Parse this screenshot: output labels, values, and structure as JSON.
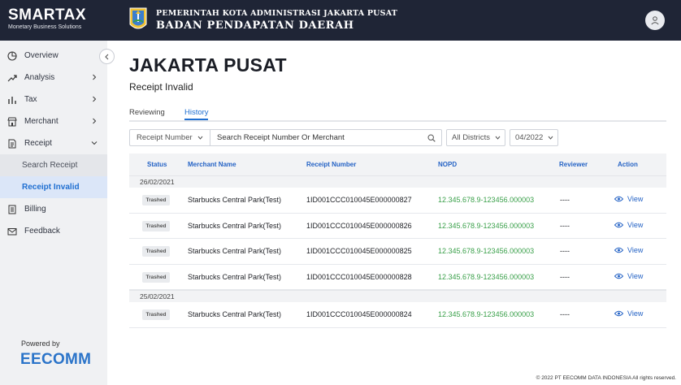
{
  "brand": {
    "name": "SMARTAX",
    "tagline": "Monetary Business Solutions"
  },
  "header": {
    "gov_line1": "PEMERINTAH KOTA ADMINISTRASI JAKARTA PUSAT",
    "gov_line2": "BADAN PENDAPATAN DAERAH"
  },
  "sidebar": {
    "items": [
      {
        "label": "Overview",
        "icon": "pie-chart-icon"
      },
      {
        "label": "Analysis",
        "icon": "trend-icon"
      },
      {
        "label": "Tax",
        "icon": "bar-chart-icon"
      },
      {
        "label": "Merchant",
        "icon": "store-icon"
      },
      {
        "label": "Receipt",
        "icon": "receipt-icon"
      },
      {
        "label": "Billing",
        "icon": "document-icon"
      },
      {
        "label": "Feedback",
        "icon": "mail-icon"
      }
    ],
    "receipt_sub": [
      {
        "label": "Search Receipt"
      },
      {
        "label": "Receipt Invalid"
      }
    ],
    "powered_by": "Powered by",
    "partner_logo": "EECOMM"
  },
  "main": {
    "city": "JAKARTA PUSAT",
    "subtitle": "Receipt Invalid",
    "tabs": [
      {
        "label": "Reviewing"
      },
      {
        "label": "History"
      }
    ],
    "filters": {
      "search_type": "Receipt Number",
      "search_placeholder": "Search Receipt Number Or Merchant",
      "district": "All Districts",
      "period": "04/2022"
    },
    "table": {
      "headers": [
        "Status",
        "Merchant Name",
        "Receipt Number",
        "NOPD",
        "Reviewer",
        "Action"
      ],
      "groups": [
        {
          "date": "26/02/2021",
          "rows": [
            {
              "status": "Trashed",
              "merchant": "Starbucks Central Park(Test)",
              "receipt": "1ID001CCC010045E000000827",
              "nopd": "12.345.678.9-123456.000003",
              "reviewer": "----",
              "action": "View"
            },
            {
              "status": "Trashed",
              "merchant": "Starbucks Central Park(Test)",
              "receipt": "1ID001CCC010045E000000826",
              "nopd": "12.345.678.9-123456.000003",
              "reviewer": "----",
              "action": "View"
            },
            {
              "status": "Trashed",
              "merchant": "Starbucks Central Park(Test)",
              "receipt": "1ID001CCC010045E000000825",
              "nopd": "12.345.678.9-123456.000003",
              "reviewer": "----",
              "action": "View"
            },
            {
              "status": "Trashed",
              "merchant": "Starbucks Central Park(Test)",
              "receipt": "1ID001CCC010045E000000828",
              "nopd": "12.345.678.9-123456.000003",
              "reviewer": "----",
              "action": "View"
            }
          ]
        },
        {
          "date": "25/02/2021",
          "rows": [
            {
              "status": "Trashed",
              "merchant": "Starbucks Central Park(Test)",
              "receipt": "1ID001CCC010045E000000824",
              "nopd": "12.345.678.9-123456.000003",
              "reviewer": "----",
              "action": "View"
            }
          ]
        }
      ]
    }
  },
  "footer": "© 2022 PT EECOMM DATA INDONESIA All rights reserved.",
  "colors": {
    "topbar": "#1f2536",
    "accent": "#1f6fd1",
    "nopd": "#3aa04a"
  }
}
